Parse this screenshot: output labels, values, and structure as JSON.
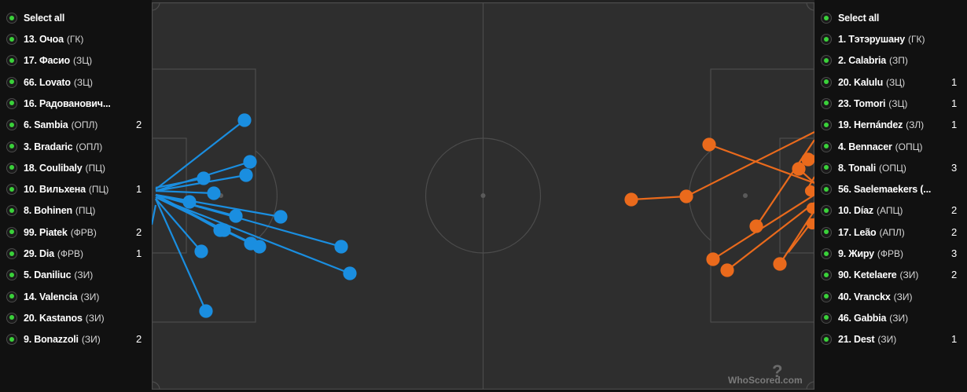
{
  "home": {
    "select_all": "Select all",
    "players": [
      {
        "name": "13. Очоа",
        "pos": "(ГК)",
        "count": ""
      },
      {
        "name": "17. Фасио",
        "pos": "(ЗЦ)",
        "count": ""
      },
      {
        "name": "66. Lovato",
        "pos": "(ЗЦ)",
        "count": ""
      },
      {
        "name": "16. Радованович...",
        "pos": "",
        "count": ""
      },
      {
        "name": "6. Sambia",
        "pos": "(ОПЛ)",
        "count": "2"
      },
      {
        "name": "3. Bradaric",
        "pos": "(ОПЛ)",
        "count": ""
      },
      {
        "name": "18. Coulibaly",
        "pos": "(ПЦ)",
        "count": ""
      },
      {
        "name": "10. Вильхена",
        "pos": "(ПЦ)",
        "count": "1"
      },
      {
        "name": "8. Bohinen",
        "pos": "(ПЦ)",
        "count": ""
      },
      {
        "name": "99. Piatek",
        "pos": "(ФРВ)",
        "count": "2"
      },
      {
        "name": "29. Dia",
        "pos": "(ФРВ)",
        "count": "1"
      },
      {
        "name": "5. Daniliuc",
        "pos": "(ЗИ)",
        "count": ""
      },
      {
        "name": "14. Valencia",
        "pos": "(ЗИ)",
        "count": ""
      },
      {
        "name": "20. Kastanos",
        "pos": "(ЗИ)",
        "count": ""
      },
      {
        "name": "9. Bonazzoli",
        "pos": "(ЗИ)",
        "count": "2"
      }
    ]
  },
  "away": {
    "select_all": "Select all",
    "players": [
      {
        "name": "1. Тэтэрушану",
        "pos": "(ГК)",
        "count": ""
      },
      {
        "name": "2. Calabria",
        "pos": "(ЗП)",
        "count": ""
      },
      {
        "name": "20. Kalulu",
        "pos": "(ЗЦ)",
        "count": "1"
      },
      {
        "name": "23. Tomori",
        "pos": "(ЗЦ)",
        "count": "1"
      },
      {
        "name": "19. Hernández",
        "pos": "(ЗЛ)",
        "count": "1"
      },
      {
        "name": "4. Bennacer",
        "pos": "(ОПЦ)",
        "count": ""
      },
      {
        "name": "8. Tonali",
        "pos": "(ОПЦ)",
        "count": "3"
      },
      {
        "name": "56. Saelemaekers (...",
        "pos": "",
        "count": ""
      },
      {
        "name": "10. Díaz",
        "pos": "(АПЦ)",
        "count": "2"
      },
      {
        "name": "17. Leão",
        "pos": "(АПЛ)",
        "count": "2"
      },
      {
        "name": "9. Жиру",
        "pos": "(ФРВ)",
        "count": "3"
      },
      {
        "name": "90. Ketelaere",
        "pos": "(ЗИ)",
        "count": "2"
      },
      {
        "name": "40. Vranckx",
        "pos": "(ЗИ)",
        "count": ""
      },
      {
        "name": "46. Gabbia",
        "pos": "(ЗИ)",
        "count": ""
      },
      {
        "name": "21. Dest",
        "pos": "(ЗИ)",
        "count": "1"
      }
    ]
  },
  "colors": {
    "home": "#1a8ee0",
    "away": "#ea6a1c",
    "pitch": "#2e2e2e",
    "lines": "#4a4a4a",
    "check": "#3ad13a"
  },
  "watermark": "WhoScored.com"
}
